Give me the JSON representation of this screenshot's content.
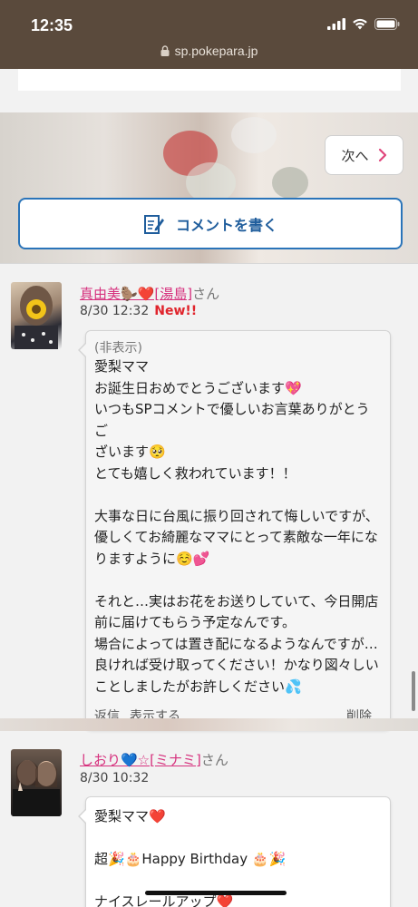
{
  "status_bar": {
    "time": "12:35",
    "url": "sp.pokepara.jp"
  },
  "nav": {
    "next_label": "次へ"
  },
  "comment_button": {
    "label": "コメントを書く"
  },
  "comments": [
    {
      "name": "真由美🦫❤️[湯島]",
      "suffix": "さん",
      "date": "8/30 12:32",
      "new_label": "New!!",
      "hidden_label": "(非表示)",
      "lines": [
        "愛梨ママ",
        "お誕生日おめでとうございます💖",
        "いつもSPコメントで優しいお言葉ありがとうご",
        "ざいます🥺",
        "とても嬉しく救われています！！",
        "",
        "大事な日に台風に振り回されて悔しいですが、",
        "優しくてお綺麗なママにとって素敵な一年にな",
        "りますように☺️💕",
        "",
        "それと…実はお花をお送りしていて、今日開店",
        "前に届けてもらう予定なんです。",
        "場合によっては置き配になるようなんですが…",
        "良ければ受け取ってください！かなり図々しい",
        "ことしましたがお許しください💦"
      ],
      "actions": {
        "reply": "返信",
        "show": "表示する",
        "delete": "削除"
      }
    },
    {
      "name": "しおり💙☆[ミナミ]",
      "suffix": "さん",
      "date": "8/30 10:32",
      "lines": [
        "愛梨ママ❤️",
        "",
        "超🎉🎂Happy Birthday 🎂🎉",
        "",
        "ナイスレールアップ❤️"
      ]
    }
  ],
  "icons": [
    "lock-icon",
    "signal-icon",
    "wifi-icon",
    "battery-icon",
    "chevron-right-icon",
    "edit-icon"
  ],
  "colors": {
    "header": "#5a4a3c",
    "name_link": "#d6307d",
    "new_badge": "#e0242c",
    "comment_button": "#2a74b9",
    "chevron": "#e0457b"
  }
}
